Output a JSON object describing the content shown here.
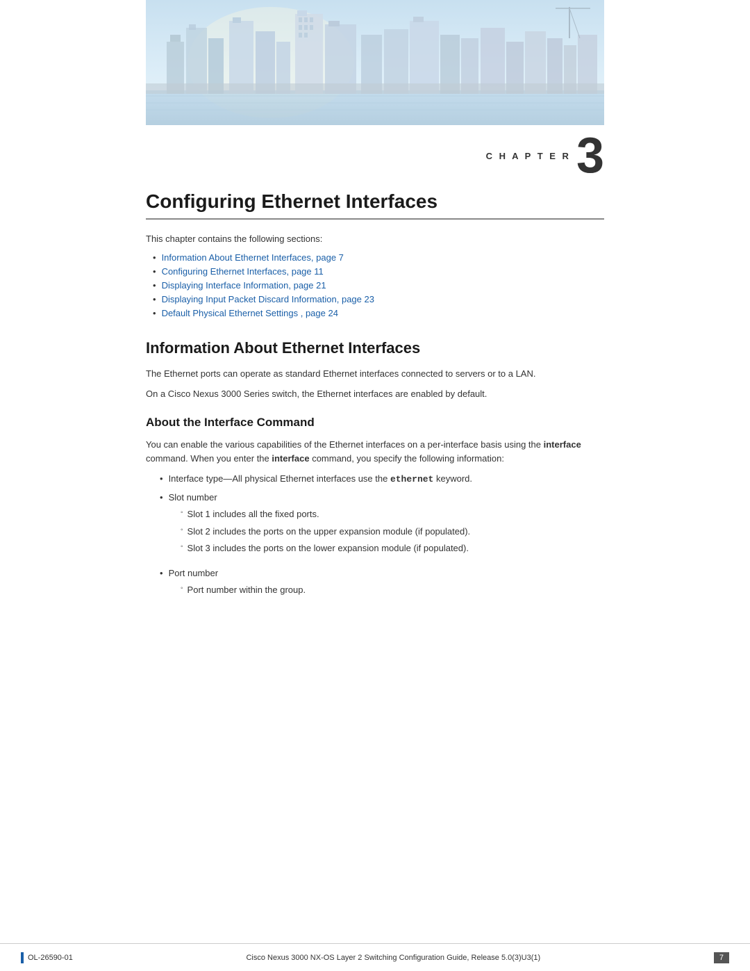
{
  "header": {
    "chapter_label": "C H A P T E R",
    "chapter_number": "3"
  },
  "chapter": {
    "title": "Configuring Ethernet Interfaces",
    "intro": "This chapter contains the following sections:"
  },
  "toc": {
    "items": [
      {
        "text": "Information About Ethernet Interfaces,  page  7"
      },
      {
        "text": "Configuring Ethernet Interfaces,  page  11"
      },
      {
        "text": "Displaying Interface Information,  page  21"
      },
      {
        "text": "Displaying Input Packet Discard Information,  page  23"
      },
      {
        "text": "Default Physical Ethernet Settings ,  page  24"
      }
    ]
  },
  "sections": {
    "s1_title": "Information About Ethernet Interfaces",
    "s1_para1": "The Ethernet ports can operate as standard Ethernet interfaces connected to servers or to a LAN.",
    "s1_para2": "On a Cisco Nexus 3000 Series switch, the Ethernet interfaces are enabled by default.",
    "s2_title": "About the Interface Command",
    "s2_para1_pre": "You can enable the various capabilities of the Ethernet interfaces on a per-interface basis using the ",
    "s2_para1_bold": "interface",
    "s2_para1_mid": " command. When you enter the ",
    "s2_para1_bold2": "interface",
    "s2_para1_post": " command, you specify the following information:",
    "bullets": [
      {
        "pre": "Interface type—All physical Ethernet interfaces use the  ",
        "code": "ethernet",
        "post": "  keyword."
      },
      {
        "text": "Slot number",
        "sub": [
          "Slot 1 includes all the fixed ports.",
          "Slot 2 includes the ports on the upper expansion module (if populated).",
          "Slot 3 includes the ports on the lower expansion module (if populated)."
        ]
      },
      {
        "text": "Port number",
        "sub": [
          "Port number within the group."
        ]
      }
    ]
  },
  "footer": {
    "doc_number": "OL-26590-01",
    "center_text": "Cisco Nexus 3000 NX-OS Layer 2 Switching Configuration Guide, Release 5.0(3)U3(1)",
    "page_number": "7"
  }
}
